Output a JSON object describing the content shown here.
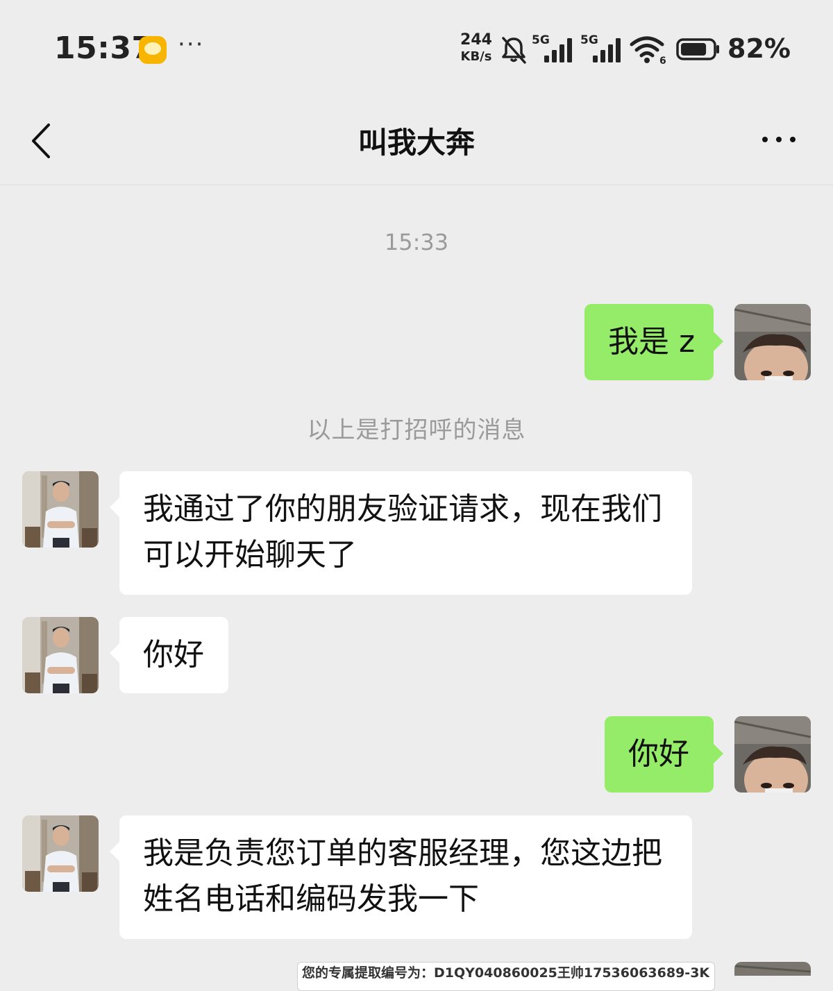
{
  "status_bar": {
    "time": "15:37",
    "more": "···",
    "net_speed_value": "244",
    "net_speed_unit": "KB/s",
    "sim1_label": "5G",
    "sim2_label": "5G",
    "wifi_label": "6",
    "battery_level": 0.82,
    "battery_percent": "82%"
  },
  "header": {
    "title": "叫我大奔"
  },
  "chat": {
    "time_divider": "15:33",
    "system_note": "以上是打招呼的消息",
    "messages": [
      {
        "from": "me",
        "lines": [
          "我是 z"
        ]
      },
      {
        "from": "contact",
        "lines": [
          "我通过了你的朋友验证请求，现在我们",
          "可以开始聊天了"
        ]
      },
      {
        "from": "contact",
        "lines": [
          "你好"
        ]
      },
      {
        "from": "me",
        "lines": [
          "你好"
        ]
      },
      {
        "from": "contact",
        "lines": [
          "我是负责您订单的客服经理，您这边把",
          "姓名电话和编码发我一下"
        ]
      }
    ],
    "image_message_text": "您的专属提取编号为：D1QY040860025王帅17536063689-3K"
  },
  "colors": {
    "background": "#ededed",
    "bubble_in": "#ffffff",
    "bubble_out": "#95ec69",
    "muted_text": "#9a9a9a"
  }
}
